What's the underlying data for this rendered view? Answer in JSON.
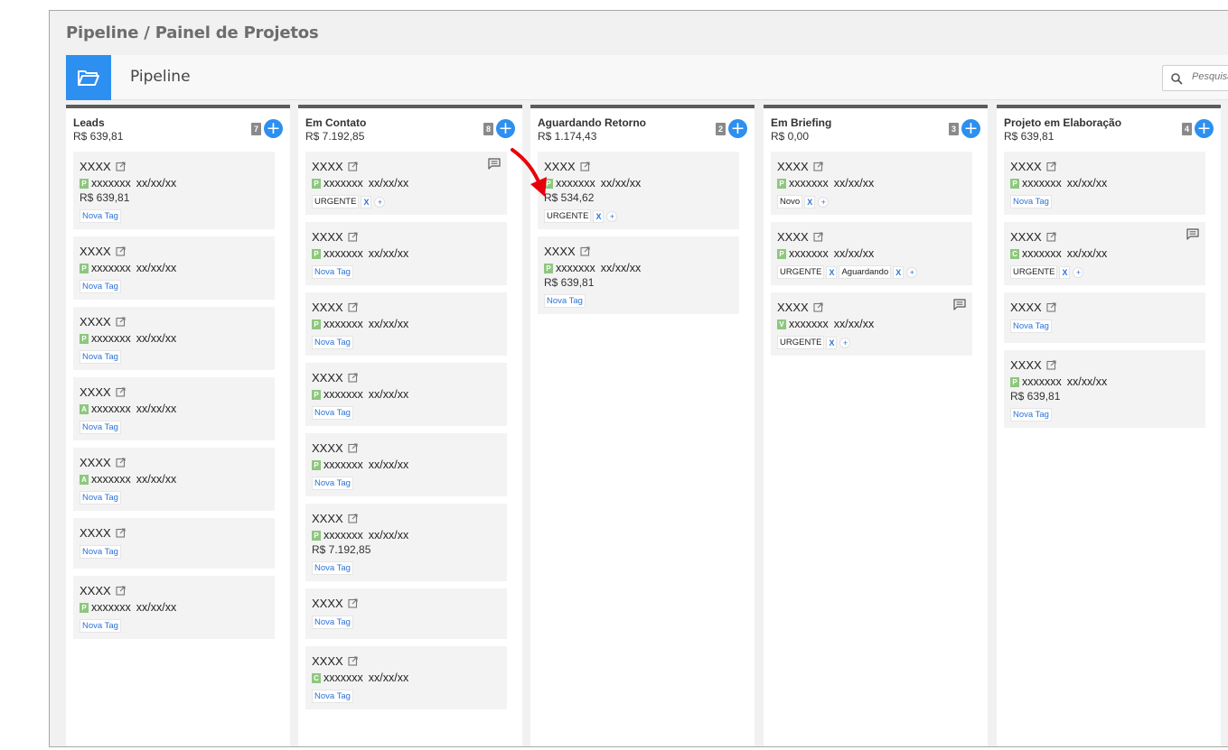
{
  "breadcrumb": "Pipeline / Painel de Projetos",
  "page_title": "Pipeline",
  "search": {
    "placeholder": "Pesquisar"
  },
  "colors": {
    "accent": "#2d8ff0",
    "badge": "#8ec77e",
    "column_border": "#5c5c5c",
    "arrow": "#e8000b"
  },
  "columns": [
    {
      "title": "Leads",
      "total": "R$ 639,81",
      "count": "7",
      "cards": [
        {
          "title": "XXXX",
          "badge": "P",
          "name": "xxxxxxx",
          "date": "xx/xx/xx",
          "value": "R$ 639,81",
          "tags": [
            {
              "type": "new",
              "label": "Nova Tag"
            }
          ]
        },
        {
          "title": "XXXX",
          "badge": "P",
          "name": "xxxxxxx",
          "date": "xx/xx/xx",
          "tags": [
            {
              "type": "new",
              "label": "Nova Tag"
            }
          ]
        },
        {
          "title": "XXXX",
          "badge": "P",
          "name": "xxxxxxx",
          "date": "xx/xx/xx",
          "tags": [
            {
              "type": "new",
              "label": "Nova Tag"
            }
          ]
        },
        {
          "title": "XXXX",
          "badge": "A",
          "name": "xxxxxxx",
          "date": "xx/xx/xx",
          "tags": [
            {
              "type": "new",
              "label": "Nova Tag"
            }
          ]
        },
        {
          "title": "XXXX",
          "badge": "A",
          "name": "xxxxxxx",
          "date": "xx/xx/xx",
          "tags": [
            {
              "type": "new",
              "label": "Nova Tag"
            }
          ]
        },
        {
          "title": "XXXX",
          "tags": [
            {
              "type": "new",
              "label": "Nova Tag"
            }
          ]
        },
        {
          "title": "XXXX",
          "badge": "P",
          "name": "xxxxxxx",
          "date": "xx/xx/xx",
          "tags": [
            {
              "type": "new",
              "label": "Nova Tag"
            }
          ]
        }
      ]
    },
    {
      "title": "Em Contato",
      "total": "R$ 7.192,85",
      "count": "8",
      "cards": [
        {
          "title": "XXXX",
          "comment": true,
          "badge": "P",
          "name": "xxxxxxx",
          "date": "xx/xx/xx",
          "tags": [
            {
              "type": "tag",
              "label": "URGENTE"
            }
          ]
        },
        {
          "title": "XXXX",
          "badge": "P",
          "name": "xxxxxxx",
          "date": "xx/xx/xx",
          "tags": [
            {
              "type": "new",
              "label": "Nova Tag"
            }
          ]
        },
        {
          "title": "XXXX",
          "badge": "P",
          "name": "xxxxxxx",
          "date": "xx/xx/xx",
          "tags": [
            {
              "type": "new",
              "label": "Nova Tag"
            }
          ]
        },
        {
          "title": "XXXX",
          "badge": "P",
          "name": "xxxxxxx",
          "date": "xx/xx/xx",
          "tags": [
            {
              "type": "new",
              "label": "Nova Tag"
            }
          ]
        },
        {
          "title": "XXXX",
          "badge": "P",
          "name": "xxxxxxx",
          "date": "xx/xx/xx",
          "tags": [
            {
              "type": "new",
              "label": "Nova Tag"
            }
          ]
        },
        {
          "title": "XXXX",
          "badge": "P",
          "name": "xxxxxxx",
          "date": "xx/xx/xx",
          "value": "R$ 7.192,85",
          "tags": [
            {
              "type": "new",
              "label": "Nova Tag"
            }
          ]
        },
        {
          "title": "XXXX",
          "tags": [
            {
              "type": "new",
              "label": "Nova Tag"
            }
          ]
        },
        {
          "title": "XXXX",
          "badge": "C",
          "name": "xxxxxxx",
          "date": "xx/xx/xx",
          "tags": [
            {
              "type": "new",
              "label": "Nova Tag"
            }
          ]
        }
      ]
    },
    {
      "title": "Aguardando Retorno",
      "total": "R$ 1.174,43",
      "count": "2",
      "cards": [
        {
          "title": "XXXX",
          "badge": "P",
          "name": "xxxxxxx",
          "date": "xx/xx/xx",
          "value": "R$ 534,62",
          "tags": [
            {
              "type": "tag",
              "label": "URGENTE"
            }
          ]
        },
        {
          "title": "XXXX",
          "badge": "P",
          "name": "xxxxxxx",
          "date": "xx/xx/xx",
          "value": "R$ 639,81",
          "tags": [
            {
              "type": "new",
              "label": "Nova Tag"
            }
          ]
        }
      ]
    },
    {
      "title": "Em Briefing",
      "total": "R$ 0,00",
      "count": "3",
      "cards": [
        {
          "title": "XXXX",
          "badge": "P",
          "name": "xxxxxxx",
          "date": "xx/xx/xx",
          "tags": [
            {
              "type": "tag",
              "label": "Novo"
            }
          ]
        },
        {
          "title": "XXXX",
          "badge": "P",
          "name": "xxxxxxx",
          "date": "xx/xx/xx",
          "tags": [
            {
              "type": "tag",
              "label": "URGENTE"
            },
            {
              "type": "tag",
              "label": "Aguardando"
            }
          ]
        },
        {
          "title": "XXXX",
          "comment": true,
          "badge": "V",
          "name": "xxxxxxx",
          "date": "xx/xx/xx",
          "tags": [
            {
              "type": "tag",
              "label": "URGENTE"
            }
          ]
        }
      ]
    },
    {
      "title": "Projeto em Elaboração",
      "total": "R$ 639,81",
      "count": "4",
      "cards": [
        {
          "title": "XXXX",
          "badge": "P",
          "name": "xxxxxxx",
          "date": "xx/xx/xx",
          "tags": [
            {
              "type": "new",
              "label": "Nova Tag"
            }
          ]
        },
        {
          "title": "XXXX",
          "comment": true,
          "badge": "C",
          "name": "xxxxxxx",
          "date": "xx/xx/xx",
          "tags": [
            {
              "type": "tag",
              "label": "URGENTE"
            }
          ]
        },
        {
          "title": "XXXX",
          "tags": [
            {
              "type": "new",
              "label": "Nova Tag"
            }
          ]
        },
        {
          "title": "XXXX",
          "badge": "P",
          "name": "xxxxxxx",
          "date": "xx/xx/xx",
          "value": "R$ 639,81",
          "tags": [
            {
              "type": "new",
              "label": "Nova Tag"
            }
          ]
        }
      ]
    }
  ],
  "tag_remove_label": "X",
  "tag_add_label": "+"
}
